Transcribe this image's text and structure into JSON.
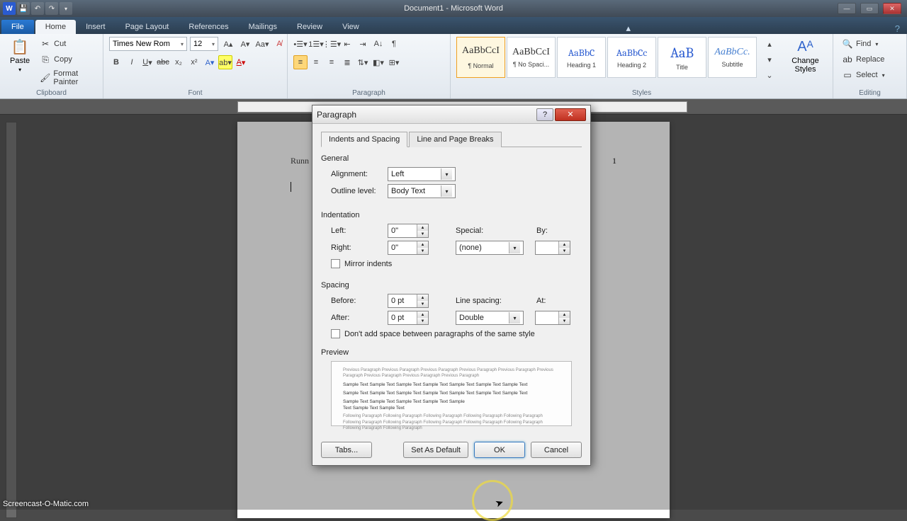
{
  "titlebar": {
    "title": "Document1 - Microsoft Word"
  },
  "tabs": {
    "file": "File",
    "items": [
      "Home",
      "Insert",
      "Page Layout",
      "References",
      "Mailings",
      "Review",
      "View"
    ],
    "active": "Home"
  },
  "ribbon": {
    "clipboard": {
      "label": "Clipboard",
      "paste": "Paste",
      "cut": "Cut",
      "copy": "Copy",
      "fmt": "Format Painter"
    },
    "font": {
      "label": "Font",
      "name": "Times New Rom",
      "size": "12"
    },
    "paragraph": {
      "label": "Paragraph"
    },
    "styles": {
      "label": "Styles",
      "items": [
        {
          "sample": "AaBbCcI",
          "name": "¶ Normal",
          "sel": true
        },
        {
          "sample": "AaBbCcI",
          "name": "¶ No Spaci..."
        },
        {
          "sample": "AaBbC",
          "name": "Heading 1",
          "blue": true
        },
        {
          "sample": "AaBbCc",
          "name": "Heading 2",
          "blue": true
        },
        {
          "sample": "AaB",
          "name": "Title",
          "blue": true
        },
        {
          "sample": "AaBbCc.",
          "name": "Subtitle",
          "ital": true
        }
      ],
      "change": "Change Styles"
    },
    "editing": {
      "label": "Editing",
      "find": "Find",
      "replace": "Replace",
      "select": "Select"
    }
  },
  "page": {
    "running": "Runn",
    "pagenum": "1"
  },
  "dialog": {
    "title": "Paragraph",
    "tabs": [
      "Indents and Spacing",
      "Line and Page Breaks"
    ],
    "general": {
      "heading": "General",
      "alignment_label": "Alignment:",
      "alignment": "Left",
      "outline_label": "Outline level:",
      "outline": "Body Text"
    },
    "indent": {
      "heading": "Indentation",
      "left_label": "Left:",
      "left": "0\"",
      "right_label": "Right:",
      "right": "0\"",
      "special_label": "Special:",
      "special": "(none)",
      "by_label": "By:",
      "by": "",
      "mirror": "Mirror indents"
    },
    "spacing": {
      "heading": "Spacing",
      "before_label": "Before:",
      "before": "0 pt",
      "after_label": "After:",
      "after": "0 pt",
      "line_label": "Line spacing:",
      "line": "Double",
      "at_label": "At:",
      "at": "",
      "noadd": "Don't add space between paragraphs of the same style"
    },
    "preview": {
      "heading": "Preview",
      "prev": "Previous Paragraph Previous Paragraph Previous Paragraph Previous Paragraph Previous Paragraph Previous Paragraph Previous Paragraph Previous Paragraph Previous Paragraph",
      "sample": "Sample Text Sample Text Sample Text Sample Text Sample Text Sample Text Sample Text",
      "next": "Following Paragraph Following Paragraph Following Paragraph Following Paragraph Following Paragraph Following Paragraph Following Paragraph Following Paragraph Following Paragraph Following Paragraph Following Paragraph Following Paragraph"
    },
    "buttons": {
      "tabs": "Tabs...",
      "default": "Set As Default",
      "ok": "OK",
      "cancel": "Cancel"
    }
  },
  "watermark": "Screencast-O-Matic.com"
}
